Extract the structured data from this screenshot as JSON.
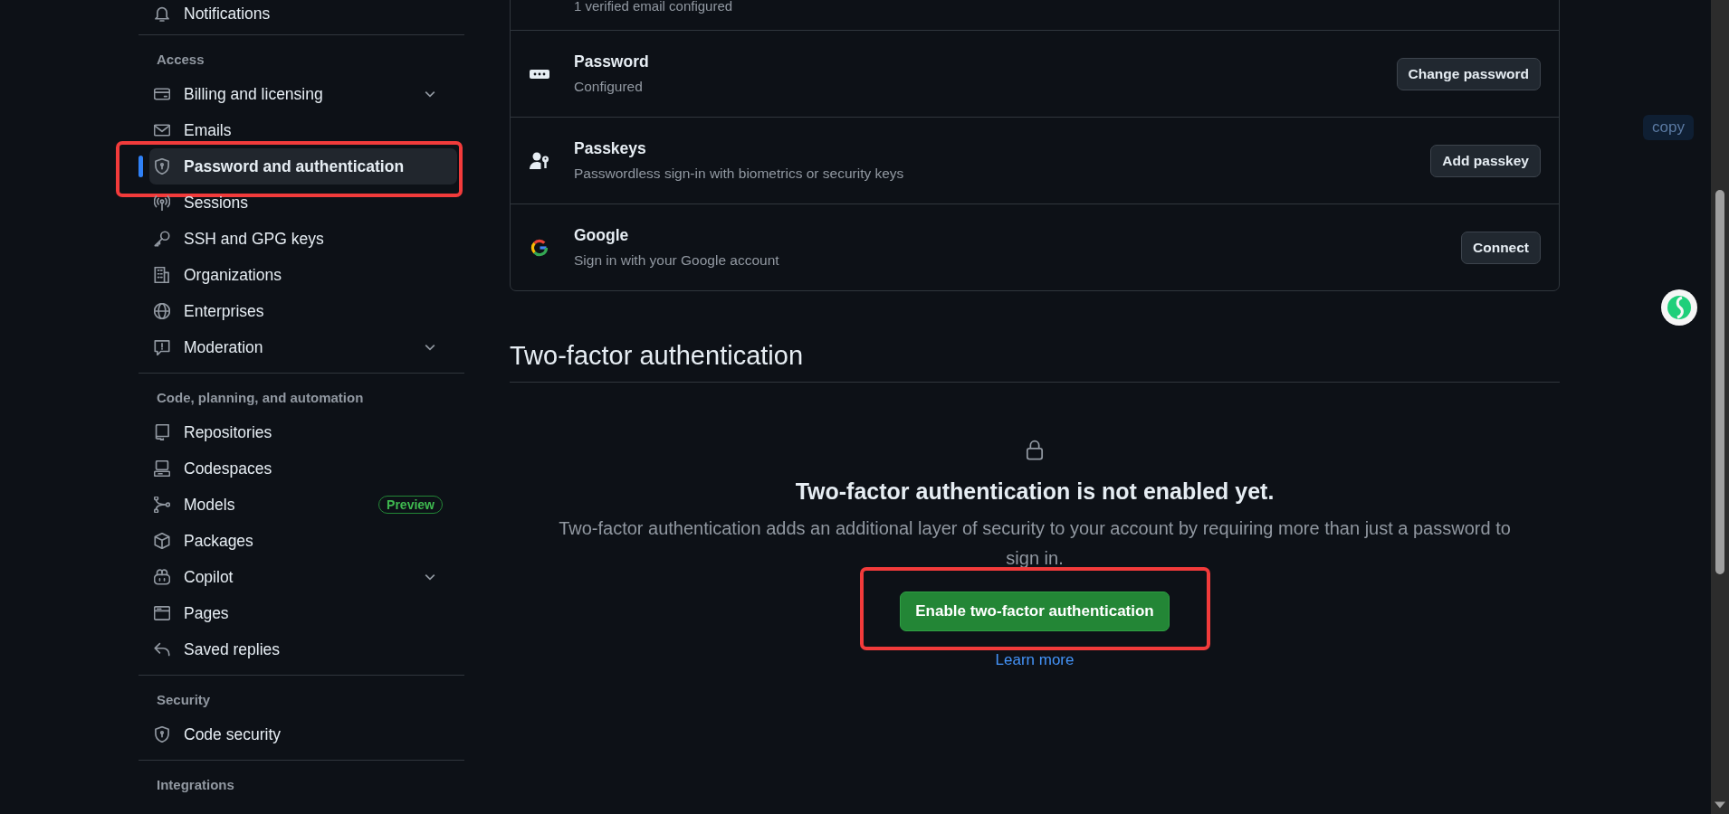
{
  "sidebar": {
    "groups": [
      {
        "items": [
          {
            "label": "Notifications",
            "selected": false
          }
        ]
      },
      {
        "heading": "Access",
        "items": [
          {
            "label": "Billing and licensing",
            "selected": false,
            "expandable": true
          },
          {
            "label": "Emails",
            "selected": false
          },
          {
            "label": "Password and authentication",
            "selected": true,
            "highlighted": true
          },
          {
            "label": "Sessions",
            "selected": false
          },
          {
            "label": "SSH and GPG keys",
            "selected": false
          },
          {
            "label": "Organizations",
            "selected": false
          },
          {
            "label": "Enterprises",
            "selected": false
          },
          {
            "label": "Moderation",
            "selected": false,
            "expandable": true
          }
        ]
      },
      {
        "heading": "Code, planning, and automation",
        "items": [
          {
            "label": "Repositories",
            "selected": false
          },
          {
            "label": "Codespaces",
            "selected": false
          },
          {
            "label": "Models",
            "selected": false,
            "badge": "Preview"
          },
          {
            "label": "Packages",
            "selected": false
          },
          {
            "label": "Copilot",
            "selected": false,
            "expandable": true
          },
          {
            "label": "Pages",
            "selected": false
          },
          {
            "label": "Saved replies",
            "selected": false
          }
        ]
      },
      {
        "heading": "Security",
        "items": [
          {
            "label": "Code security",
            "selected": false
          }
        ]
      },
      {
        "heading": "Integrations"
      }
    ]
  },
  "email_row": {
    "status": "1 verified email configured"
  },
  "methods": [
    {
      "name": "Password",
      "description": "Configured",
      "action": "Change password"
    },
    {
      "name": "Passkeys",
      "description": "Passwordless sign-in with biometrics or security keys",
      "action": "Add passkey"
    },
    {
      "name": "Google",
      "description": "Sign in with your Google account",
      "action": "Connect"
    }
  ],
  "two_factor": {
    "heading": "Two-factor authentication",
    "title": "Two-factor authentication is not enabled yet.",
    "description": "Two-factor authentication adds an additional layer of security to your account by requiring more than just a password to sign in.",
    "button": {
      "label": "Enable two-factor authentication",
      "highlighted": true
    },
    "link": "Learn more"
  },
  "copy_button": "copy"
}
